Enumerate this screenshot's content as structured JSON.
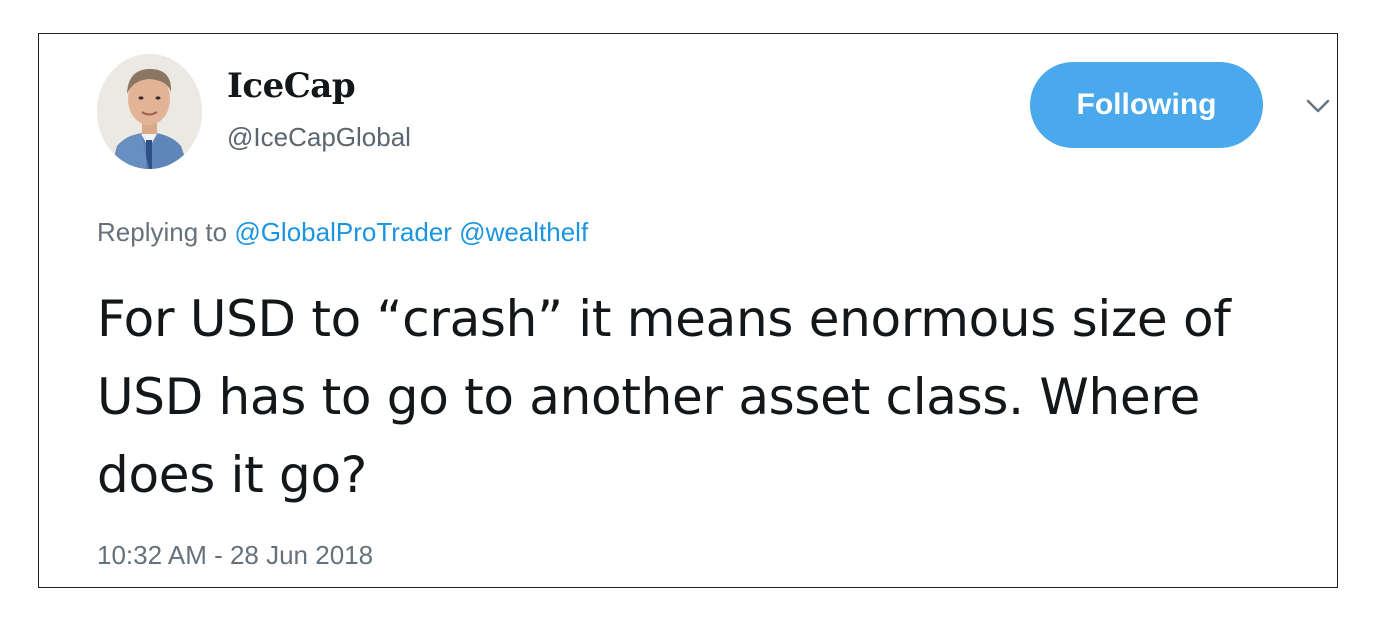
{
  "tweet": {
    "author": {
      "display_name": "IceCap",
      "handle": "@IceCapGlobal",
      "avatar_icon": "profile-photo"
    },
    "follow_button": {
      "label": "Following",
      "color": "#4aa8ec"
    },
    "menu_icon": "chevron-down-icon",
    "reply": {
      "prefix": "Replying to",
      "mentions": [
        "@GlobalProTrader",
        "@wealthelf"
      ],
      "mention_color": "#1b95e0"
    },
    "text": "For USD to “crash” it means enormous size of USD has to go to another asset class. Where does it go?",
    "timestamp": "10:32 AM - 28 Jun 2018"
  }
}
